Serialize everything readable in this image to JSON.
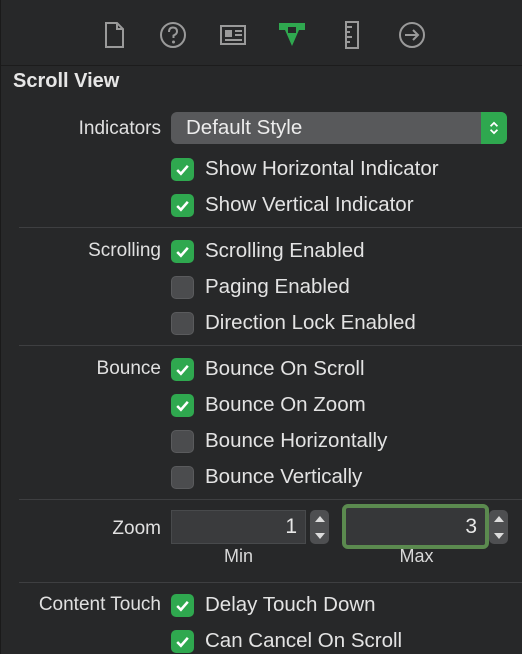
{
  "toolbar": {
    "icons": [
      {
        "name": "file-inspector-icon"
      },
      {
        "name": "quick-help-icon"
      },
      {
        "name": "identity-inspector-icon"
      },
      {
        "name": "attributes-inspector-icon",
        "active": true
      },
      {
        "name": "size-inspector-icon"
      },
      {
        "name": "connections-inspector-icon"
      }
    ],
    "active_color": "#2fa84f"
  },
  "section_title": "Scroll View",
  "indicators": {
    "label": "Indicators",
    "style_value": "Default Style",
    "show_horizontal": {
      "label": "Show Horizontal Indicator",
      "checked": true
    },
    "show_vertical": {
      "label": "Show Vertical Indicator",
      "checked": true
    }
  },
  "scrolling": {
    "label": "Scrolling",
    "enabled": {
      "label": "Scrolling Enabled",
      "checked": true
    },
    "paging": {
      "label": "Paging Enabled",
      "checked": false
    },
    "direction_lock": {
      "label": "Direction Lock Enabled",
      "checked": false
    }
  },
  "bounce": {
    "label": "Bounce",
    "on_scroll": {
      "label": "Bounce On Scroll",
      "checked": true
    },
    "on_zoom": {
      "label": "Bounce On Zoom",
      "checked": true
    },
    "horizontally": {
      "label": "Bounce Horizontally",
      "checked": false
    },
    "vertically": {
      "label": "Bounce Vertically",
      "checked": false
    }
  },
  "zoom": {
    "label": "Zoom",
    "min_value": "1",
    "max_value": "3",
    "min_label": "Min",
    "max_label": "Max"
  },
  "content_touch": {
    "label": "Content Touch",
    "delay_touch_down": {
      "label": "Delay Touch Down",
      "checked": true
    },
    "can_cancel": {
      "label": "Can Cancel On Scroll",
      "checked": true
    }
  },
  "colors": {
    "checkbox_on": "#2fa84f",
    "background": "#272829",
    "focus_ring": "#5b8a4f"
  }
}
